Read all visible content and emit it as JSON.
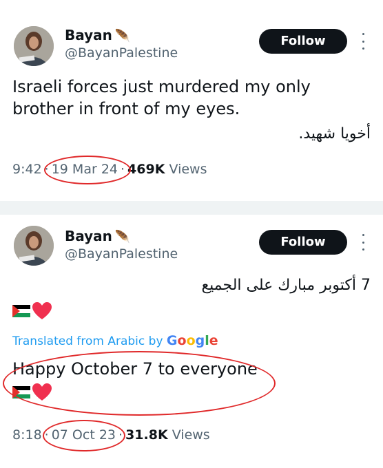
{
  "tweets": [
    {
      "author_name": "Bayan",
      "author_sign": "🪶",
      "handle": "@BayanPalestine",
      "follow_label": "Follow",
      "text_en": "Israeli forces just murdered my only brother in front of my eyes.",
      "text_ar": "أخويا شهيد.",
      "time": "9:42",
      "date": "19 Mar 24",
      "views_count": "469K",
      "views_label": "Views",
      "separator": "·"
    },
    {
      "author_name": "Bayan",
      "author_sign": "🪶",
      "handle": "@BayanPalestine",
      "follow_label": "Follow",
      "text_ar": "7 أكتوبر مبارك على الجميع",
      "translated_label": "Translated from Arabic by",
      "google_label": "Google",
      "text_en": "Happy October 7 to everyone",
      "time": "8:18",
      "date": "07 Oct 23",
      "views_count": "31.8K",
      "views_label": "Views",
      "separator": "·"
    }
  ],
  "colors": {
    "follow_bg": "#0f1419",
    "muted_text": "#536471",
    "annotation_red": "#e0292a",
    "link_blue": "#1d9bf0"
  },
  "icons": [
    "more-options-icon",
    "palestine-flag-icon",
    "red-heart-icon",
    "avatar-image"
  ]
}
